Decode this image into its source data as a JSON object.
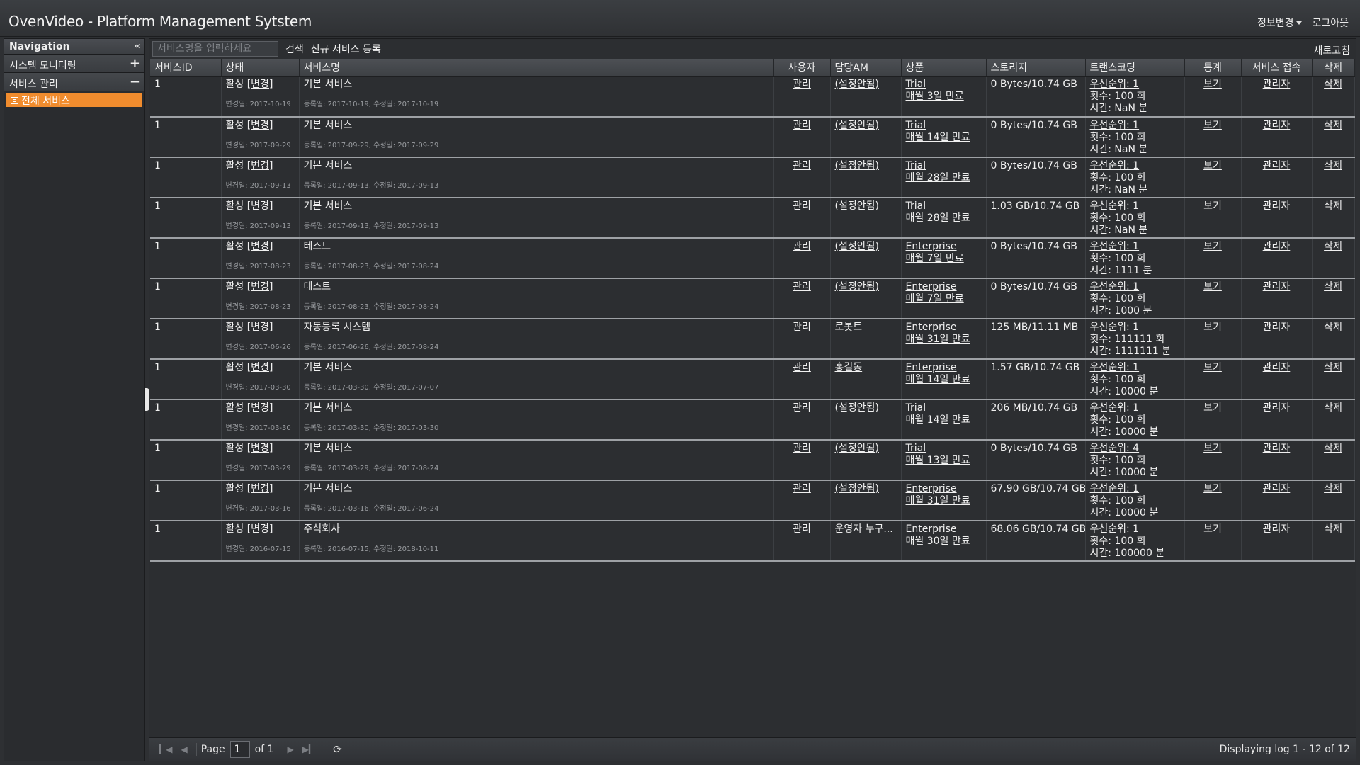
{
  "app": {
    "title": "OvenVideo - Platform Management Sytstem",
    "top_links": {
      "info_change": "정보변경",
      "logout": "로그아웃"
    }
  },
  "sidebar": {
    "header": "Navigation",
    "groups": [
      {
        "label": "시스템 모니터링",
        "sign": "+"
      },
      {
        "label": "서비스 관리",
        "sign": "−"
      }
    ],
    "active_item": "전체 서비스"
  },
  "toolbar": {
    "search_placeholder": "서비스명을 입력하세요",
    "search_label": "검색",
    "register_label": "신규 서비스 등록",
    "refresh_label": "새로고침"
  },
  "table": {
    "columns": [
      "서비스ID",
      "상태",
      "서비스명",
      "사용자",
      "담당AM",
      "상품",
      "스토리지",
      "트랜스코딩",
      "통계",
      "서비스 접속",
      "삭제"
    ],
    "rows": [
      {
        "id": "1",
        "status": "활성",
        "change": "[변경]",
        "changed_date": "변경일: 2017-10-19",
        "name": "기본 서비스",
        "dates": "등록일: 2017-10-19, 수정일: 2017-10-19",
        "user": "관리",
        "am": "(설정안됨)",
        "product": "Trial",
        "expiry": "매월 3일 만료",
        "storage": "0 Bytes/10.74 GB",
        "priority": "우선순위: 1",
        "count": "횟수: 100 회",
        "time": "시간: NaN 분",
        "stats": "보기",
        "access": "관리자",
        "delete": "삭제"
      },
      {
        "id": "1",
        "status": "활성",
        "change": "[변경]",
        "changed_date": "변경일: 2017-09-29",
        "name": "기본 서비스",
        "dates": "등록일: 2017-09-29, 수정일: 2017-09-29",
        "user": "관리",
        "am": "(설정안됨)",
        "product": "Trial",
        "expiry": "매월 14일 만료",
        "storage": "0 Bytes/10.74 GB",
        "priority": "우선순위: 1",
        "count": "횟수: 100 회",
        "time": "시간: NaN 분",
        "stats": "보기",
        "access": "관리자",
        "delete": "삭제"
      },
      {
        "id": "1",
        "status": "활성",
        "change": "[변경]",
        "changed_date": "변경일: 2017-09-13",
        "name": "기본 서비스",
        "dates": "등록일: 2017-09-13, 수정일: 2017-09-13",
        "user": "관리",
        "am": "(설정안됨)",
        "product": "Trial",
        "expiry": "매월 28일 만료",
        "storage": "0 Bytes/10.74 GB",
        "priority": "우선순위: 1",
        "count": "횟수: 100 회",
        "time": "시간: NaN 분",
        "stats": "보기",
        "access": "관리자",
        "delete": "삭제"
      },
      {
        "id": "1",
        "status": "활성",
        "change": "[변경]",
        "changed_date": "변경일: 2017-09-13",
        "name": "기본 서비스",
        "dates": "등록일: 2017-09-13, 수정일: 2017-09-13",
        "user": "관리",
        "am": "(설정안됨)",
        "product": "Trial",
        "expiry": "매월 28일 만료",
        "storage": "1.03 GB/10.74 GB",
        "priority": "우선순위: 1",
        "count": "횟수: 100 회",
        "time": "시간: NaN 분",
        "stats": "보기",
        "access": "관리자",
        "delete": "삭제"
      },
      {
        "id": "1",
        "status": "활성",
        "change": "[변경]",
        "changed_date": "변경일: 2017-08-23",
        "name": "테스트",
        "dates": "등록일: 2017-08-23, 수정일: 2017-08-24",
        "user": "관리",
        "am": "(설정안됨)",
        "product": "Enterprise",
        "expiry": "매월 7일 만료",
        "storage": "0 Bytes/10.74 GB",
        "priority": "우선순위: 1",
        "count": "횟수: 100 회",
        "time": "시간: 1111 분",
        "stats": "보기",
        "access": "관리자",
        "delete": "삭제"
      },
      {
        "id": "1",
        "status": "활성",
        "change": "[변경]",
        "changed_date": "변경일: 2017-08-23",
        "name": "테스트",
        "dates": "등록일: 2017-08-23, 수정일: 2017-08-24",
        "user": "관리",
        "am": "(설정안됨)",
        "product": "Enterprise",
        "expiry": "매월 7일 만료",
        "storage": "0 Bytes/10.74 GB",
        "priority": "우선순위: 1",
        "count": "횟수: 100 회",
        "time": "시간: 1000 분",
        "stats": "보기",
        "access": "관리자",
        "delete": "삭제"
      },
      {
        "id": "1",
        "status": "활성",
        "change": "[변경]",
        "changed_date": "변경일: 2017-06-26",
        "name": "자동등록 시스템",
        "dates": "등록일: 2017-06-26, 수정일: 2017-08-24",
        "user": "관리",
        "am": "로봇트",
        "product": "Enterprise",
        "expiry": "매월 31일 만료",
        "storage": "125 MB/11.11 MB",
        "priority": "우선순위: 1",
        "count": "횟수: 111111 회",
        "time": "시간: 1111111 분",
        "stats": "보기",
        "access": "관리자",
        "delete": "삭제"
      },
      {
        "id": "1",
        "status": "활성",
        "change": "[변경]",
        "changed_date": "변경일: 2017-03-30",
        "name": "기본 서비스",
        "dates": "등록일: 2017-03-30, 수정일: 2017-07-07",
        "user": "관리",
        "am": "홍길동",
        "product": "Enterprise",
        "expiry": "매월 14일 만료",
        "storage": "1.57 GB/10.74 GB",
        "priority": "우선순위: 1",
        "count": "횟수: 100 회",
        "time": "시간: 10000 분",
        "stats": "보기",
        "access": "관리자",
        "delete": "삭제"
      },
      {
        "id": "1",
        "status": "활성",
        "change": "[변경]",
        "changed_date": "변경일: 2017-03-30",
        "name": "기본 서비스",
        "dates": "등록일: 2017-03-30, 수정일: 2017-03-30",
        "user": "관리",
        "am": "(설정안됨)",
        "product": "Trial",
        "expiry": "매월 14일 만료",
        "storage": "206 MB/10.74 GB",
        "priority": "우선순위: 1",
        "count": "횟수: 100 회",
        "time": "시간: 10000 분",
        "stats": "보기",
        "access": "관리자",
        "delete": "삭제"
      },
      {
        "id": "1",
        "status": "활성",
        "change": "[변경]",
        "changed_date": "변경일: 2017-03-29",
        "name": "기본 서비스",
        "dates": "등록일: 2017-03-29, 수정일: 2017-08-24",
        "user": "관리",
        "am": "(설정안됨)",
        "product": "Trial",
        "expiry": "매월 13일 만료",
        "storage": "0 Bytes/10.74 GB",
        "priority": "우선순위: 4",
        "count": "횟수: 100 회",
        "time": "시간: 10000 분",
        "stats": "보기",
        "access": "관리자",
        "delete": "삭제"
      },
      {
        "id": "1",
        "status": "활성",
        "change": "[변경]",
        "changed_date": "변경일: 2017-03-16",
        "name": "기본 서비스",
        "dates": "등록일: 2017-03-16, 수정일: 2017-06-24",
        "user": "관리",
        "am": "(설정안됨)",
        "product": "Enterprise",
        "expiry": "매월 31일 만료",
        "storage": "67.90 GB/10.74 GB",
        "priority": "우선순위: 1",
        "count": "횟수: 100 회",
        "time": "시간: 10000 분",
        "stats": "보기",
        "access": "관리자",
        "delete": "삭제"
      },
      {
        "id": "1",
        "status": "활성",
        "change": "[변경]",
        "changed_date": "변경일: 2016-07-15",
        "name": "주식회사",
        "dates": "등록일: 2016-07-15, 수정일: 2018-10-11",
        "user": "관리",
        "am": "운영자 누구...",
        "product": "Enterprise",
        "expiry": "매월 30일 만료",
        "storage": "68.06 GB/10.74 GB",
        "priority": "우선순위: 1",
        "count": "횟수: 100 회",
        "time": "시간: 100000 분",
        "stats": "보기",
        "access": "관리자",
        "delete": "삭제"
      }
    ]
  },
  "pager": {
    "page_label": "Page",
    "page_value": "1",
    "of_label": "of 1",
    "display_info": "Displaying log 1 - 12 of 12"
  }
}
